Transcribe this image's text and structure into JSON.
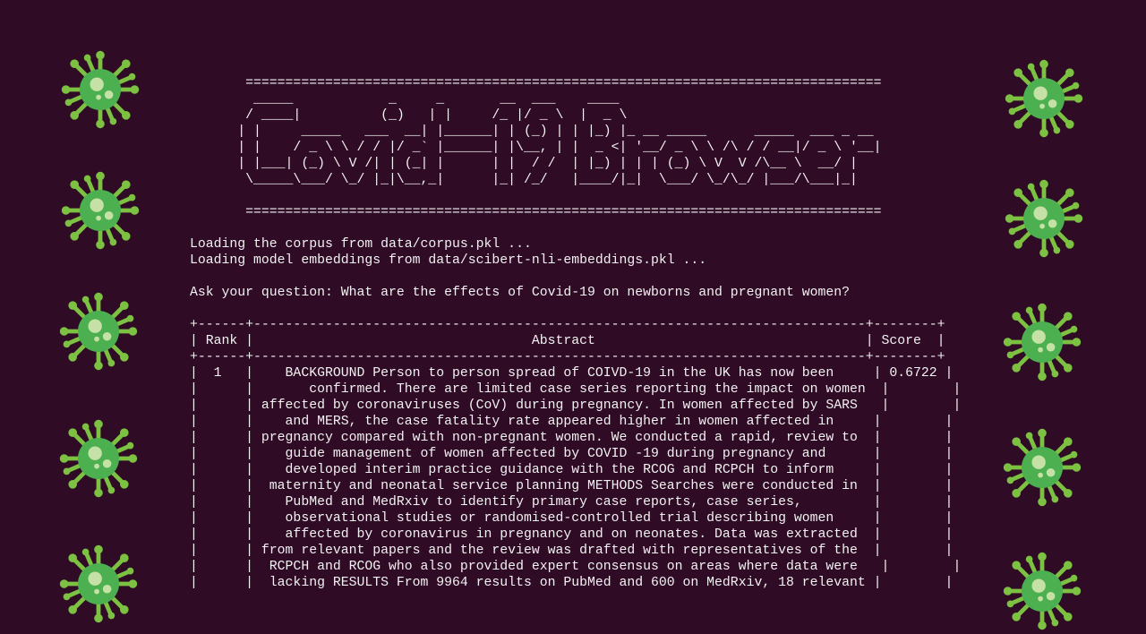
{
  "terminal": {
    "lines": [
      "       ================================================================================",
      "        _____            _     _       __  ___    ____",
      "       / ____|          (_)   | |     /_ |/ _ \\  |  _ \\",
      "      | |     _____   ___  __| |______| | (_) | | |_) |_ __ _____      _____  ___ _ __",
      "      | |    / _ \\ \\ / / |/ _` |______| |\\__, | |  _ <| '__/ _ \\ \\ /\\ / / __|/ _ \\ '__|",
      "      | |___| (_) \\ V /| | (_| |      | |  / /  | |_) | | | (_) \\ V  V /\\__ \\  __/ |",
      "       \\_____\\___/ \\_/ |_|\\__,_|      |_| /_/   |____/|_|  \\___/ \\_/\\_/ |___/\\___|_|",
      "",
      "       ================================================================================",
      "",
      "Loading the corpus from data/corpus.pkl ...",
      "Loading model embeddings from data/scibert-nli-embeddings.pkl ...",
      "",
      "Ask your question: What are the effects of Covid-19 on newborns and pregnant women?",
      "",
      "+------+-----------------------------------------------------------------------------+--------+",
      "| Rank |                                   Abstract                                  | Score  |",
      "+------+-----------------------------------------------------------------------------+--------+",
      "|  1   |    BACKGROUND Person to person spread of COIVD-19 in the UK has now been     | 0.6722 |",
      "|      |       confirmed. There are limited case series reporting the impact on women  |        |",
      "|      | affected by coronaviruses (CoV) during pregnancy. In women affected by SARS   |        |",
      "|      |    and MERS, the case fatality rate appeared higher in women affected in     |        |",
      "|      | pregnancy compared with non-pregnant women. We conducted a rapid, review to  |        |",
      "|      |    guide management of women affected by COVID -19 during pregnancy and      |        |",
      "|      |    developed interim practice guidance with the RCOG and RCPCH to inform     |        |",
      "|      |  maternity and neonatal service planning METHODS Searches were conducted in  |        |",
      "|      |    PubMed and MedRxiv to identify primary case reports, case series,         |        |",
      "|      |    observational studies or randomised-controlled trial describing women     |        |",
      "|      |    affected by coronavirus in pregnancy and on neonates. Data was extracted  |        |",
      "|      | from relevant papers and the review was drafted with representatives of the  |        |",
      "|      |  RCPCH and RCOG who also provided expert consensus on areas where data were   |        |",
      "|      |  lacking RESULTS From 9964 results on PubMed and 600 on MedRxiv, 18 relevant |        |"
    ]
  },
  "decorations": {
    "icon": "virus-icon",
    "colors": {
      "background": "#2f0b25",
      "virus_body": "#4caf50",
      "virus_spike": "#8bc34a",
      "virus_spot": "#c5e1a5"
    }
  }
}
